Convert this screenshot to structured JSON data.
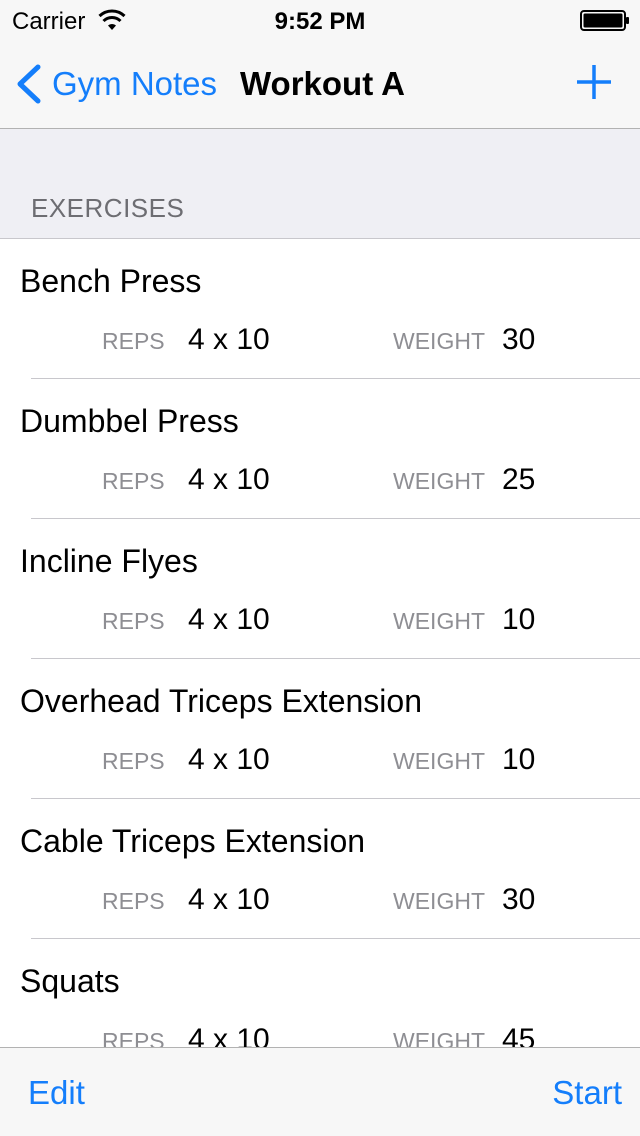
{
  "status_bar": {
    "carrier": "Carrier",
    "time": "9:52 PM",
    "wifi_icon": "wifi-icon",
    "battery_icon": "battery-icon"
  },
  "nav_bar": {
    "back_label": "Gym Notes",
    "back_icon": "chevron-left-icon",
    "title": "Workout A",
    "add_icon": "plus-icon"
  },
  "section": {
    "header": "EXERCISES"
  },
  "exercises": [
    {
      "name": "Bench Press",
      "reps_label": "REPS",
      "reps": "4 x 10",
      "weight_label": "WEIGHT",
      "weight": "30"
    },
    {
      "name": "Dumbbel Press",
      "reps_label": "REPS",
      "reps": "4 x 10",
      "weight_label": "WEIGHT",
      "weight": "25"
    },
    {
      "name": "Incline Flyes",
      "reps_label": "REPS",
      "reps": "4 x 10",
      "weight_label": "WEIGHT",
      "weight": "10"
    },
    {
      "name": "Overhead Triceps Extension",
      "reps_label": "REPS",
      "reps": "4 x 10",
      "weight_label": "WEIGHT",
      "weight": "10"
    },
    {
      "name": "Cable Triceps Extension",
      "reps_label": "REPS",
      "reps": "4 x 10",
      "weight_label": "WEIGHT",
      "weight": "30"
    },
    {
      "name": "Squats",
      "reps_label": "REPS",
      "reps": "4 x 10",
      "weight_label": "WEIGHT",
      "weight": "45"
    }
  ],
  "toolbar": {
    "edit_label": "Edit",
    "start_label": "Start"
  },
  "colors": {
    "accent": "#147efb",
    "secondary_text": "#8e8e93",
    "background": "#efeff4"
  }
}
